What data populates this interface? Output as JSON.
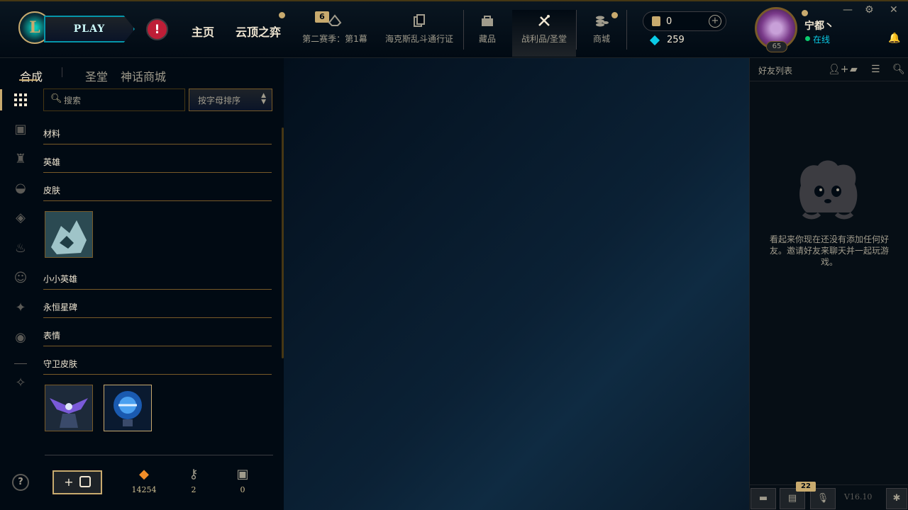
{
  "topbar": {
    "logo_text": "L",
    "play_label": "PLAY",
    "alert_symbol": "!",
    "nav_main": [
      "主页",
      "云顶之弈"
    ],
    "nav_sub": [
      {
        "label": "第二赛季：第1幕",
        "icon": "pass-icon",
        "badge": "6"
      },
      {
        "label": "海克斯乱斗通行证",
        "icon": "cards-icon"
      },
      {
        "label": "藏品",
        "icon": "collection-icon"
      },
      {
        "label": "战利品/圣堂",
        "icon": "loot-icon"
      },
      {
        "label": "商城",
        "icon": "store-icon"
      }
    ],
    "blue_essence": "0",
    "riot_points": "259",
    "username": "宁都丶",
    "status": "在线",
    "level": "65"
  },
  "tabs": {
    "items": [
      "合成",
      "圣堂",
      "神话商城"
    ],
    "active": "合成"
  },
  "search": {
    "placeholder": "搜索"
  },
  "sort": {
    "label": "按字母排序"
  },
  "categories": [
    "材料",
    "英雄",
    "皮肤",
    "小小英雄",
    "永恒星碑",
    "表情",
    "守卫皮肤"
  ],
  "bottom": {
    "add_label": "+",
    "orange_essence": "14254",
    "keys": "2",
    "chests": "0"
  },
  "friends": {
    "title": "好友列表",
    "empty_message": "看起来你现在还没有添加任何好友。邀请好友来聊天并一起玩游戏。",
    "badge": "22",
    "version": "V16.10"
  },
  "colors": {
    "gold": "#c8aa6e",
    "dark_gold": "#785a28",
    "background": "#010a13",
    "text": "#a09b8c",
    "bright_text": "#f0e6d2",
    "online": "#0acb6e"
  }
}
